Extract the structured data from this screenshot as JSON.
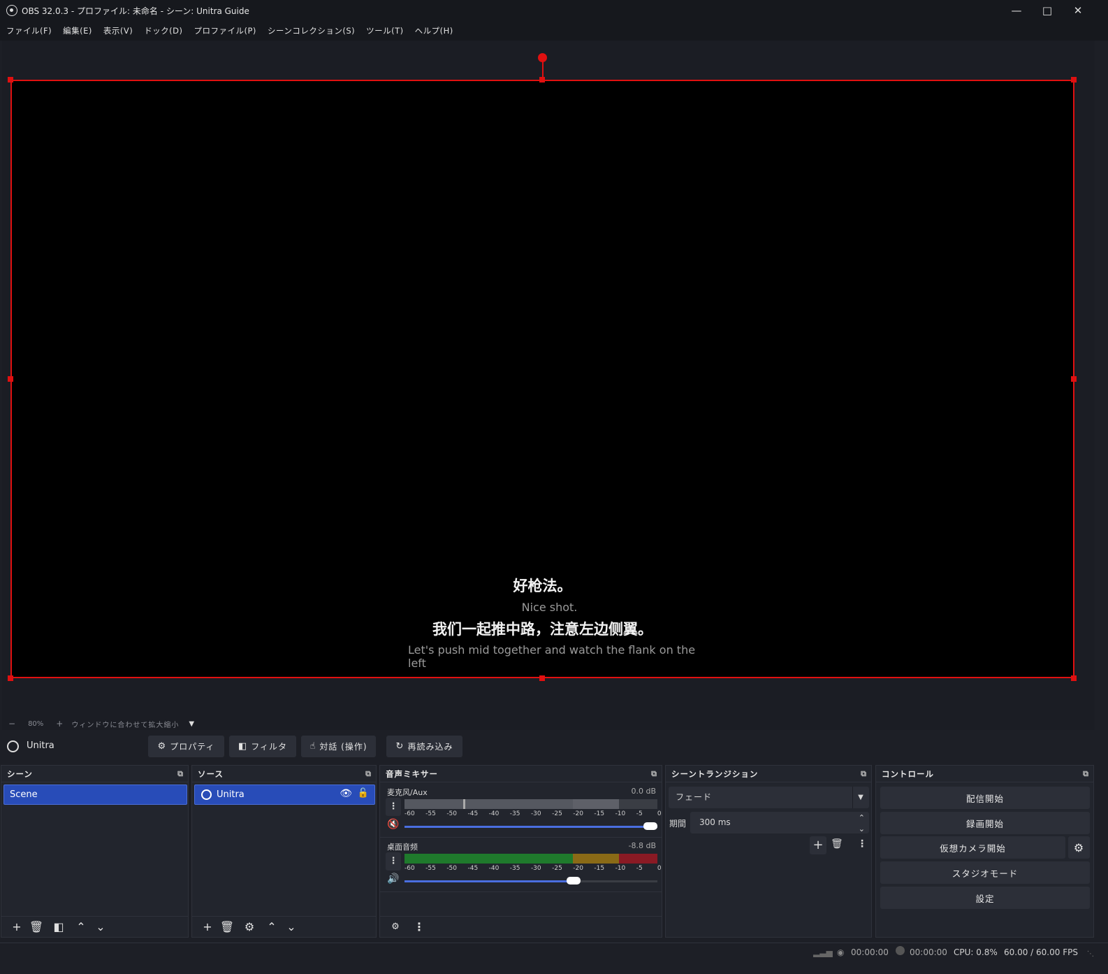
{
  "window": {
    "title": "OBS 32.0.3 - プロファイル: 未命名 - シーン: Unitra Guide",
    "minimize_icon": "minimize-icon",
    "maximize_icon": "maximize-icon",
    "close_icon": "close-icon"
  },
  "menu": [
    "ファイル(F)",
    "編集(E)",
    "表示(V)",
    "ドック(D)",
    "プロファイル(P)",
    "シーンコレクション(S)",
    "ツール(T)",
    "ヘルプ(H)"
  ],
  "preview": {
    "subtitles": [
      {
        "text": "好枪法。",
        "lang": "zh"
      },
      {
        "text": "Nice shot.",
        "lang": "en"
      },
      {
        "text": "我们一起推中路，注意左边侧翼。",
        "lang": "zh"
      },
      {
        "text": "Let's push mid together and watch the flank on the",
        "lang": "en"
      },
      {
        "text": "left",
        "lang": "en"
      }
    ],
    "selection_color": "#e01010"
  },
  "zoom": {
    "minus": "−",
    "value": "80%",
    "plus": "+",
    "fit_label": "ウィンドウに合わせて拡大縮小"
  },
  "source_toolbar": {
    "source_name": "Unitra",
    "properties": "プロパティ",
    "filters": "フィルタ",
    "interact": "対話 (操作)",
    "reload": "再読み込み"
  },
  "scenes": {
    "title": "シーン",
    "items": [
      "Scene"
    ]
  },
  "sources": {
    "title": "ソース",
    "items": [
      "Unitra"
    ]
  },
  "mixer": {
    "title": "音声ミキサー",
    "scale": [
      "-60",
      "-55",
      "-50",
      "-45",
      "-40",
      "-35",
      "-30",
      "-25",
      "-20",
      "-15",
      "-10",
      "-5",
      "0"
    ],
    "channels": [
      {
        "name": "麦克风/Aux",
        "db": "0.0 dB",
        "muted": true,
        "volume": 1.0,
        "level": 0.0
      },
      {
        "name": "桌面音频",
        "db": "-8.8 dB",
        "muted": false,
        "volume": 0.67,
        "level": 1.0
      }
    ]
  },
  "transitions": {
    "title": "シーントランジション",
    "selected": "フェード",
    "duration_label": "期間",
    "duration_value": "300 ms"
  },
  "controls": {
    "title": "コントロール",
    "buttons": [
      "配信開始",
      "録画開始",
      "仮想カメラ開始",
      "スタジオモード",
      "設定"
    ]
  },
  "status": {
    "stream_time": "00:00:00",
    "record_time": "00:00:00",
    "cpu": "CPU: 0.8%",
    "fps": "60.00 / 60.00 FPS"
  },
  "colors": {
    "accent": "#284cb8",
    "meter_green": "#1f7a2c",
    "meter_yellow": "#8a6a16",
    "meter_red": "#8a1a24",
    "volume_blue": "#4a6ee0"
  }
}
